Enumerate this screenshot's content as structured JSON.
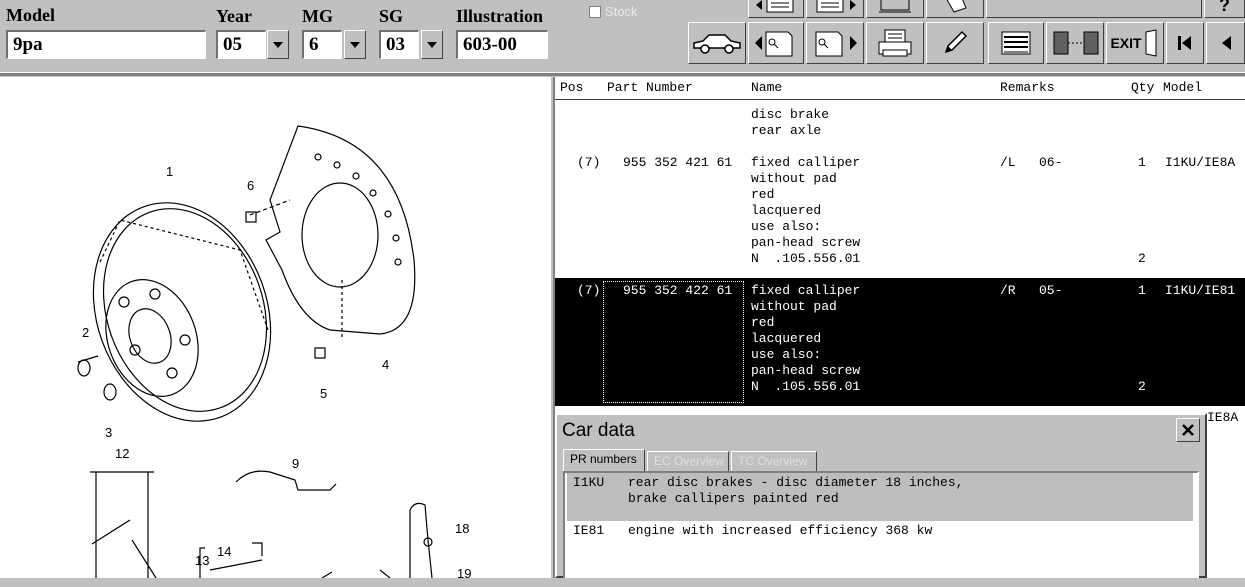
{
  "header": {
    "model_label": "Model",
    "model_value": "9pa",
    "year_label": "Year",
    "year_value": "05",
    "mg_label": "MG",
    "mg_value": "6",
    "sg_label": "SG",
    "sg_value": "03",
    "illustration_label": "Illustration",
    "illustration_value": "603-00",
    "stock_label": "Stock",
    "exit_label": "EXIT"
  },
  "table": {
    "columns": [
      "Pos",
      "Part Number",
      "Name",
      "Remarks",
      "Qty",
      "Model"
    ],
    "group_title": [
      "disc brake",
      "rear axle"
    ],
    "rows": [
      {
        "pos": "(7)",
        "part": "955 352 421 61",
        "name": [
          "fixed calliper",
          "without pad",
          "red",
          "lacquered",
          "use also:",
          "pan-head screw",
          "N  .105.556.01"
        ],
        "remarks": "/L   06-",
        "qty": "1",
        "qty2": "2",
        "model": "I1KU/IE8A",
        "selected": false
      },
      {
        "pos": "(7)",
        "part": "955 352 422 61",
        "name": [
          "fixed calliper",
          "without pad",
          "red",
          "lacquered",
          "use also:",
          "pan-head screw",
          "N  .105.556.01"
        ],
        "remarks": "/R   05-",
        "qty": "1",
        "qty2": "2",
        "model": "I1KU/IE81",
        "selected": true
      }
    ],
    "partial_model": "IE8A"
  },
  "dialog": {
    "title": "Car data",
    "tabs": [
      "PR numbers",
      "EC Overview",
      "TC Overview"
    ],
    "pr_items": [
      {
        "code": "I1KU",
        "text": "rear disc brakes - disc diameter 18 inches,",
        "text2": "brake callipers painted red",
        "highlighted": true
      },
      {
        "code": "IE81",
        "text": "engine with increased efficiency 368 kw",
        "text2": "",
        "highlighted": false
      }
    ]
  },
  "illustration": {
    "callouts": [
      "1",
      "2",
      "3",
      "4",
      "5",
      "6",
      "9",
      "12",
      "13",
      "14",
      "18",
      "19"
    ]
  }
}
